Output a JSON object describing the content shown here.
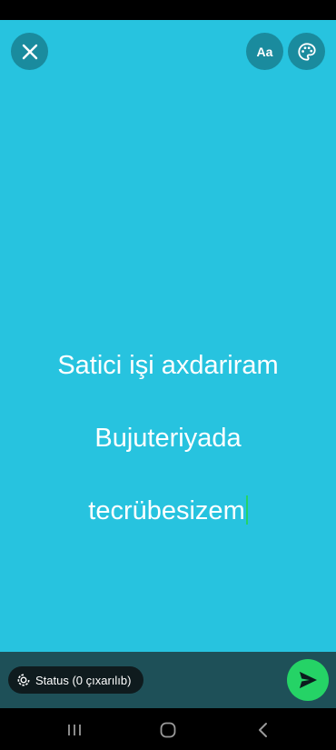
{
  "editor": {
    "text_lines": [
      "Satici işi axdariram",
      "Bujuteriyada",
      "tecrübesizem"
    ],
    "background_color": "#27c3df",
    "font_button_label": "Aa"
  },
  "toolbar": {
    "close_icon": "close-icon",
    "palette_icon": "palette-icon"
  },
  "footer": {
    "audience_label": "Status (0 çıxarılıb)",
    "send_icon": "send-icon",
    "accent_color": "#25d366"
  },
  "nav": {
    "recent_icon": "recent-apps-icon",
    "home_icon": "home-icon",
    "back_icon": "back-icon"
  }
}
